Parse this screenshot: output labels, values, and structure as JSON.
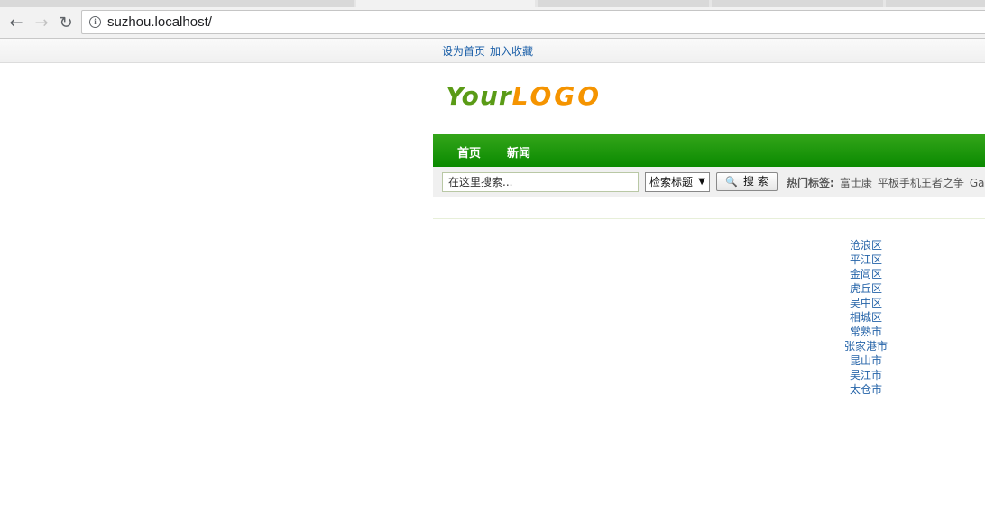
{
  "browser": {
    "url": "suzhou.localhost/"
  },
  "topbar": {
    "set_home": "设为首页",
    "add_favorite": "加入收藏"
  },
  "logo": {
    "part1": "Your",
    "part2": "LOGO"
  },
  "nav": {
    "items": [
      "首页",
      "新闻"
    ]
  },
  "search": {
    "placeholder": "在这里搜索...",
    "select_value": "检索标题",
    "button_label": "搜 索",
    "hot_label": "热门标签:",
    "hot_tags": [
      "富士康",
      "平板手机王者之争",
      "Ga"
    ]
  },
  "districts": [
    "沧浪区",
    "平江区",
    "金阊区",
    "虎丘区",
    "吴中区",
    "相城区",
    "常熟市",
    "张家港市",
    "昆山市",
    "吴江市",
    "太仓市"
  ],
  "colors": {
    "nav_green": "#1a9a0a",
    "logo_green": "#5a9b16",
    "logo_orange": "#f59400",
    "link_blue": "#2463a8"
  }
}
